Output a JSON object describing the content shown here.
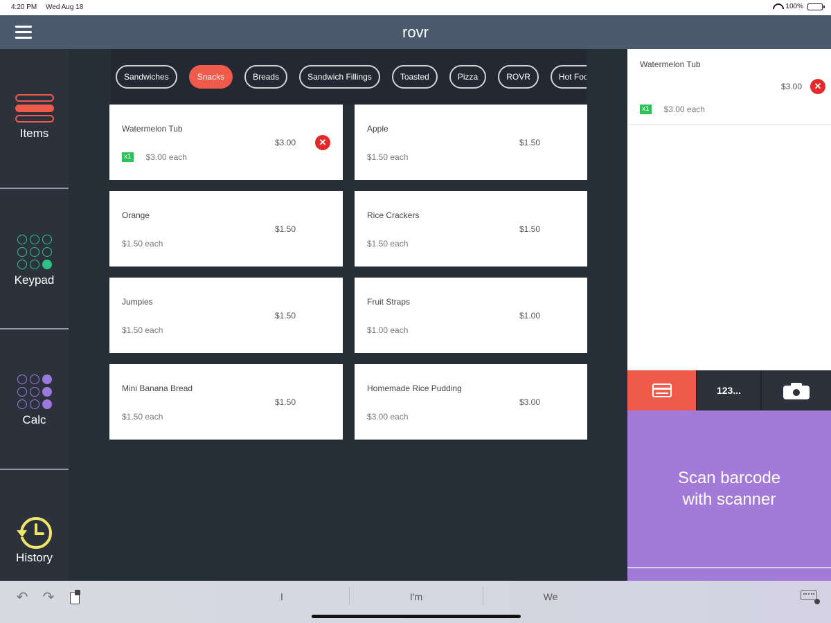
{
  "status_bar": {
    "time": "4:20 PM",
    "date": "Wed Aug 18",
    "battery": "100%"
  },
  "header": {
    "title": "rovr"
  },
  "nav": {
    "items": [
      {
        "label": "Items",
        "icon": "items-icon"
      },
      {
        "label": "Keypad",
        "icon": "keypad-icon"
      },
      {
        "label": "Calc",
        "icon": "calc-icon"
      },
      {
        "label": "History",
        "icon": "history-icon"
      }
    ]
  },
  "categories": [
    "Sandwiches",
    "Snacks",
    "Breads",
    "Sandwich Fillings",
    "Toasted",
    "Pizza",
    "ROVR",
    "Hot Food"
  ],
  "active_category": "Snacks",
  "products": [
    {
      "name": "Watermelon Tub",
      "price": "$3.00",
      "each": "$3.00 each",
      "qty": "x1"
    },
    {
      "name": "Apple",
      "price": "$1.50",
      "each": "$1.50 each"
    },
    {
      "name": "Orange",
      "price": "$1.50",
      "each": "$1.50 each"
    },
    {
      "name": "Rice Crackers",
      "price": "$1.50",
      "each": "$1.50 each"
    },
    {
      "name": "Jumpies",
      "price": "$1.50",
      "each": "$1.50 each"
    },
    {
      "name": "Fruit Straps",
      "price": "$1.00",
      "each": "$1.00 each"
    },
    {
      "name": "Mini Banana Bread",
      "price": "$1.50",
      "each": "$1.50 each"
    },
    {
      "name": "Homemade Rice Pudding",
      "price": "$3.00",
      "each": "$3.00 each"
    }
  ],
  "cart": {
    "items": [
      {
        "name": "Watermelon Tub",
        "price": "$3.00",
        "qty": "x1",
        "each": "$3.00 each"
      }
    ]
  },
  "mode_bar": {
    "keys_label": "123..."
  },
  "scan": {
    "line1": "Scan barcode",
    "line2": "with scanner"
  },
  "keyboard_bar": {
    "suggestions": [
      "I",
      "I'm",
      "We"
    ]
  },
  "colors": {
    "accent_red": "#f05a4b",
    "accent_green": "#2ec185",
    "accent_purple": "#a47ad9",
    "header": "#4a5a6c",
    "background": "#262e38"
  }
}
